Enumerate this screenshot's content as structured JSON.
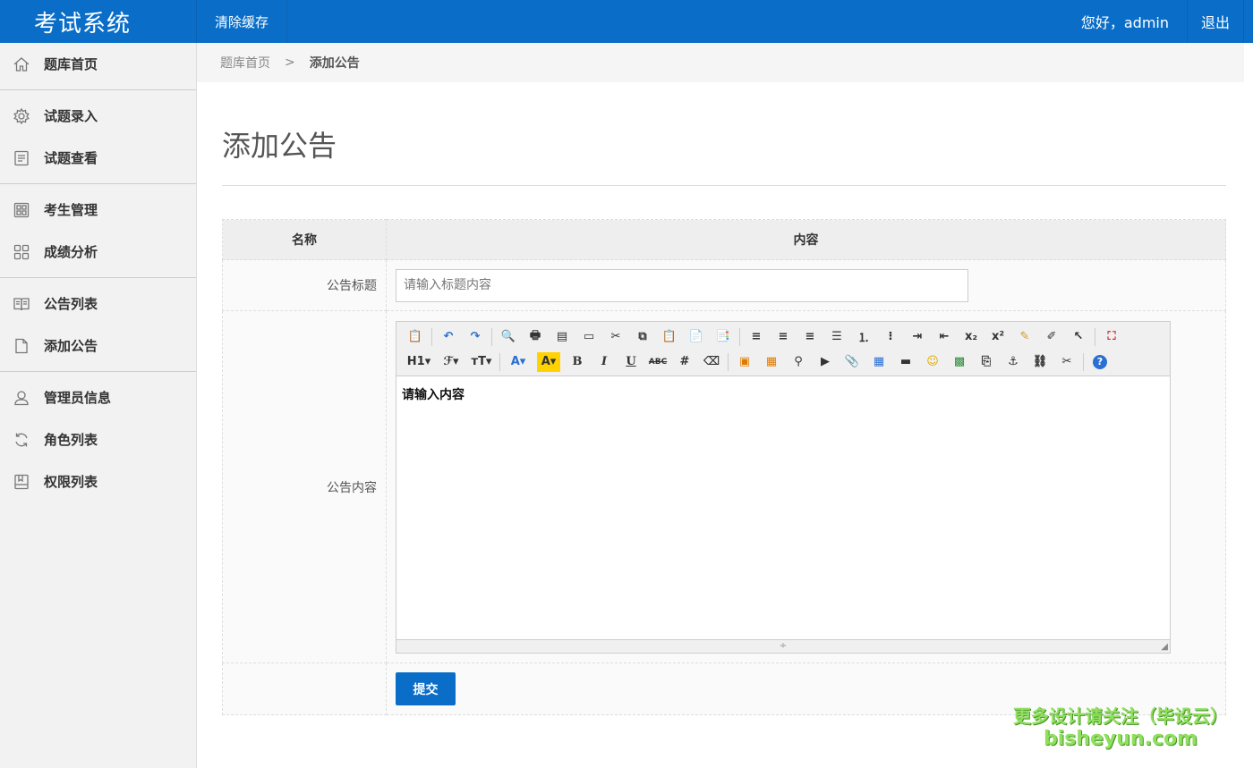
{
  "header": {
    "brand": "考试系统",
    "clear_cache": "清除缓存",
    "greeting": "您好，admin",
    "logout": "退出"
  },
  "sidebar": {
    "items": [
      {
        "label": "题库首页",
        "icon": "home-icon"
      },
      {
        "label": "试题录入",
        "icon": "gear-icon"
      },
      {
        "label": "试题查看",
        "icon": "document-icon"
      },
      {
        "label": "考生管理",
        "icon": "grid-icon"
      },
      {
        "label": "成绩分析",
        "icon": "apps-icon"
      },
      {
        "label": "公告列表",
        "icon": "book-icon"
      },
      {
        "label": "添加公告",
        "icon": "file-icon"
      },
      {
        "label": "管理员信息",
        "icon": "user-icon"
      },
      {
        "label": "角色列表",
        "icon": "refresh-icon"
      },
      {
        "label": "权限列表",
        "icon": "bookmark-icon"
      }
    ]
  },
  "breadcrumb": {
    "home": "题库首页",
    "separator": ">",
    "current": "添加公告"
  },
  "page": {
    "title": "添加公告"
  },
  "form": {
    "col_name": "名称",
    "col_content": "内容",
    "title_label": "公告标题",
    "title_placeholder": "请输入标题内容",
    "title_value": "",
    "content_label": "公告内容",
    "content_text": "请输入内容",
    "submit": "提交"
  },
  "watermark": {
    "line1": "更多设计请关注（毕设云）",
    "line2": "bisheyun.com"
  }
}
